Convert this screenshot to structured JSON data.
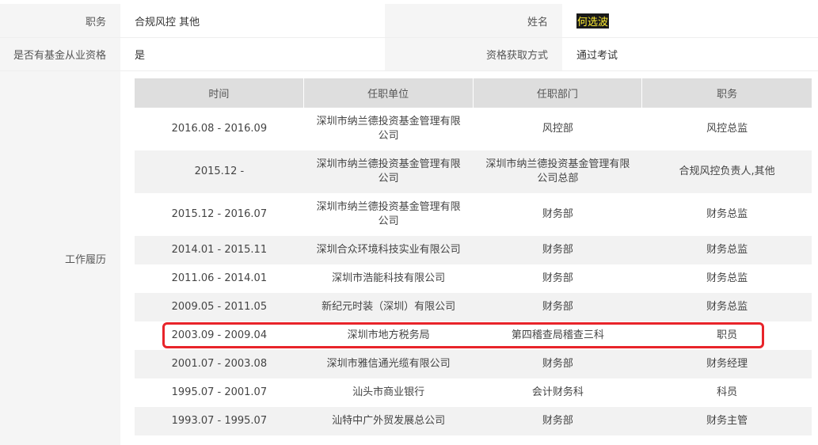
{
  "position_row": {
    "label": "职务",
    "value": "合规风控 其他",
    "name_label": "姓名",
    "name_value": "何选波"
  },
  "qualification_row": {
    "label": "是否有基金从业资格",
    "value": "是",
    "method_label": "资格获取方式",
    "method_value": "通过考试"
  },
  "career": {
    "label": "工作履历",
    "headers": [
      "时间",
      "任职单位",
      "任职部门",
      "职务"
    ],
    "rows": [
      [
        "2016.08 - 2016.09",
        "深圳市纳兰德投资基金管理有限公司",
        "风控部",
        "风控总监"
      ],
      [
        "2015.12 -",
        "深圳市纳兰德投资基金管理有限公司",
        "深圳市纳兰德投资基金管理有限公司总部",
        "合规风控负责人,其他"
      ],
      [
        "2015.12 - 2016.07",
        "深圳市纳兰德投资基金管理有限公司",
        "财务部",
        "财务总监"
      ],
      [
        "2014.01 - 2015.11",
        "深圳合众环境科技实业有限公司",
        "财务部",
        "财务总监"
      ],
      [
        "2011.06 - 2014.01",
        "深圳市浩能科技有限公司",
        "财务部",
        "财务总监"
      ],
      [
        "2009.05 - 2011.05",
        "新纪元时装（深圳）有限公司",
        "财务部",
        "财务总监"
      ],
      [
        "2003.09 - 2009.04",
        "深圳市地方税务局",
        "第四稽查局稽查三科",
        "职员"
      ],
      [
        "2001.07 - 2003.08",
        "深圳市雅信通光缆有限公司",
        "财务部",
        "财务经理"
      ],
      [
        "1995.07 - 2001.07",
        "汕头市商业银行",
        "会计财务科",
        "科员"
      ],
      [
        "1993.07 - 1995.07",
        "汕特中广外贸发展总公司",
        "财务部",
        "财务主管"
      ]
    ]
  },
  "colors": {
    "label_bg": "#f5f5f5",
    "header_bg": "#dedede",
    "stripe_bg": "#f2f2f2",
    "highlight_border": "#e8242a",
    "name_highlight_bg": "#1a1a1a",
    "name_highlight_fg": "#ffee33"
  }
}
